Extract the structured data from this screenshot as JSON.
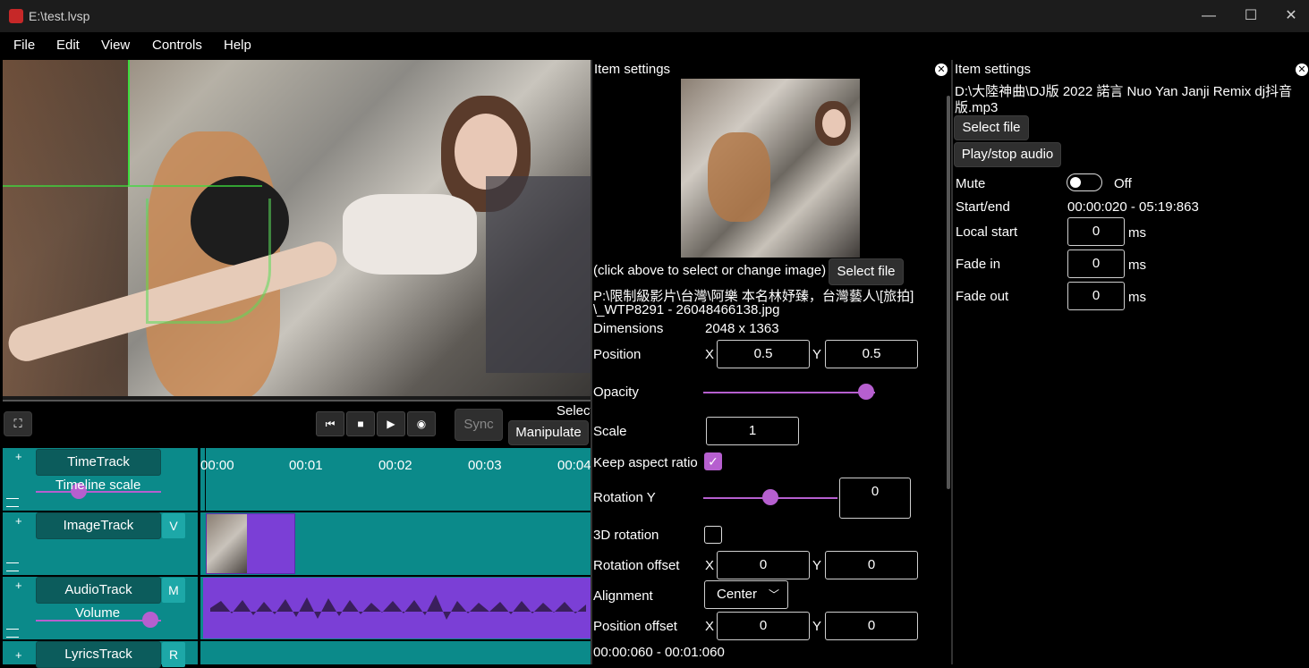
{
  "window": {
    "title": "E:\\test.lvsp",
    "minimize": "—",
    "maximize": "☐",
    "close": "✕"
  },
  "menu": [
    "File",
    "Edit",
    "View",
    "Controls",
    "Help"
  ],
  "transport": {
    "fullscreen": "⛶",
    "skip_back": "⏮",
    "stop": "■",
    "play": "▶",
    "record": "◉",
    "sync": "Sync",
    "select": "Select",
    "manipulate": "Manipulate"
  },
  "timeline": {
    "ticks": [
      "00:00",
      "00:01",
      "00:02",
      "00:03",
      "00:04"
    ],
    "tracks": [
      {
        "name": "TimeTrack",
        "sub": "Timeline scale",
        "tag": ""
      },
      {
        "name": "ImageTrack",
        "sub": "",
        "tag": "V"
      },
      {
        "name": "AudioTrack",
        "sub": "Volume",
        "tag": "M"
      },
      {
        "name": "LyricsTrack",
        "sub": "",
        "tag": "R"
      }
    ],
    "add": "+"
  },
  "image_panel": {
    "title": "Item settings",
    "hint": "(click above to select or change image)",
    "select_file": "Select file",
    "path_line1": "P:\\限制級影片\\台灣\\阿樂 本名林妤臻，台灣藝人\\[旅拍]",
    "path_line2": "\\_WTP8291 - 26048466138.jpg",
    "dimensions_label": "Dimensions",
    "dimensions_value": "2048 x 1363",
    "position_label": "Position",
    "position_x": "0.5",
    "position_y": "0.5",
    "x": "X",
    "y": "Y",
    "opacity_label": "Opacity",
    "opacity_value": 0.95,
    "scale_label": "Scale",
    "scale_value": "1",
    "keep_aspect_label": "Keep aspect ratio",
    "check": "✓",
    "rotation_y_label": "Rotation Y",
    "rotation_y_value": "0",
    "rotation3d_label": "3D rotation",
    "rotation_offset_label": "Rotation offset",
    "rotation_offset_x": "0",
    "rotation_offset_y": "0",
    "alignment_label": "Alignment",
    "alignment_value": "Center",
    "position_offset_label": "Position offset",
    "position_offset_x": "0",
    "position_offset_y": "0",
    "time_range": "00:00:060 - 00:01:060"
  },
  "audio_panel": {
    "title": "Item settings",
    "path_line1": "D:\\大陸神曲\\DJ版 2022 諾言 Nuo Yan Janji Remix dj抖音",
    "path_line2": "版.mp3",
    "select_file": "Select file",
    "play_stop": "Play/stop audio",
    "mute_label": "Mute",
    "mute_state": "Off",
    "start_end_label": "Start/end",
    "start_end_value": "00:00:020 - 05:19:863",
    "local_start_label": "Local start",
    "local_start_value": "0",
    "fade_in_label": "Fade in",
    "fade_in_value": "0",
    "fade_out_label": "Fade out",
    "fade_out_value": "0",
    "ms": "ms"
  },
  "colors": {
    "accent": "#b65fcf",
    "teal": "#0b8a8a",
    "clip": "#7b3fd6"
  }
}
